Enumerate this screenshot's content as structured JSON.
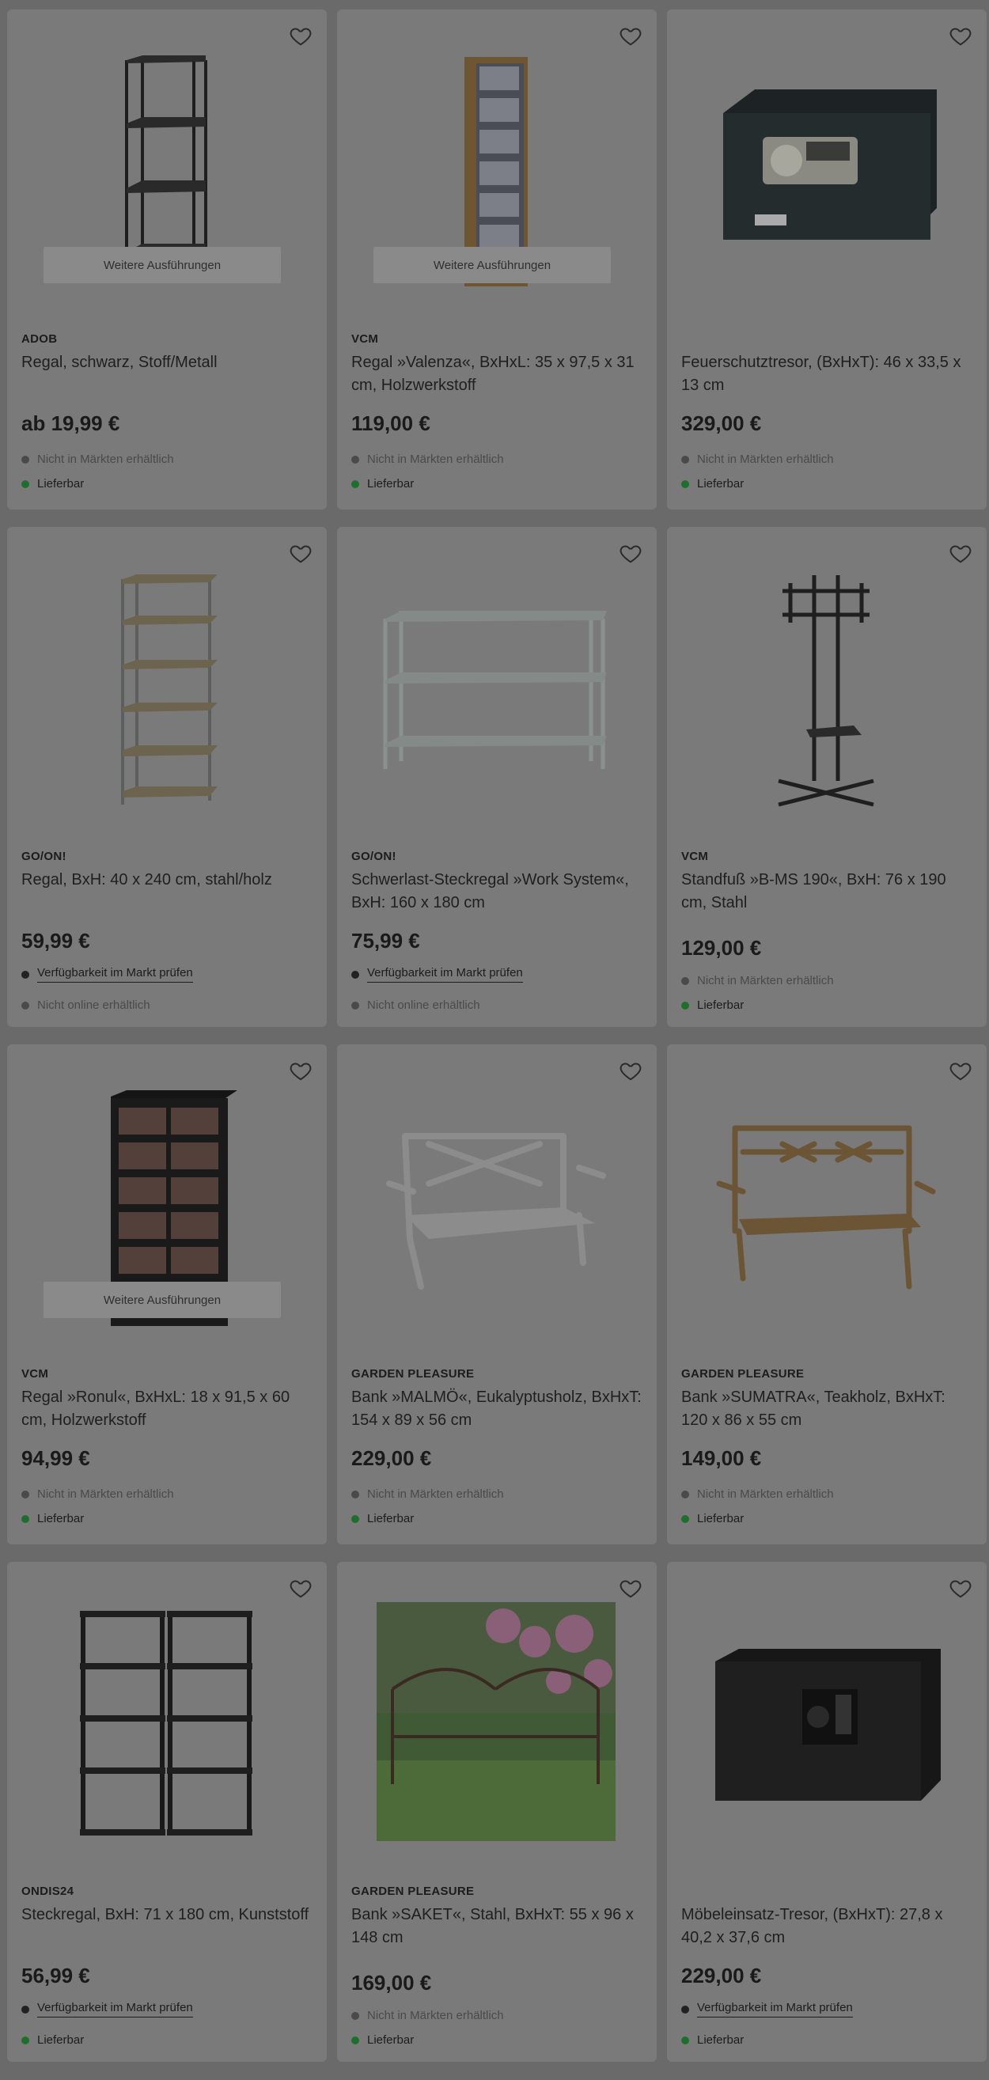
{
  "variants_label": "Weitere Ausführungen",
  "products": [
    {
      "brand": "ADOB",
      "title": "Regal, schwarz, Stoff/Metall",
      "price": "ab 19,99 €",
      "status1": "Nicht in Märkten erhältlich",
      "status2": "Lieferbar",
      "image": "black-metal-shelf-icon"
    },
    {
      "brand": "VCM",
      "title": "Regal »Valenza«, BxHxL: 35 x 97,5 x 31 cm, Holzwerkstoff",
      "price": "119,00 €",
      "status1": "Nicht in Märkten erhältlich",
      "status2": "Lieferbar",
      "image": "cd-tower-icon"
    },
    {
      "brand": "",
      "title": "Feuerschutztresor, (BxHxT): 46 x 33,5 x 13 cm",
      "price": "329,00 €",
      "status1": "Nicht in Märkten erhältlich",
      "status2": "Lieferbar",
      "image": "fire-safe-icon"
    },
    {
      "brand": "GO/ON!",
      "title": "Regal, BxH: 40 x 240 cm, stahl/holz",
      "price": "59,99 €",
      "status1": "Verfügbarkeit im Markt prüfen",
      "status2": "Nicht online erhältlich",
      "image": "steel-wood-shelf-icon"
    },
    {
      "brand": "GO/ON!",
      "title": "Schwerlast-Steckregal »Work System«, BxH: 160 x 180 cm",
      "price": "75,99 €",
      "status1": "Verfügbarkeit im Markt prüfen",
      "status2": "Nicht online erhältlich",
      "image": "heavy-duty-rack-icon"
    },
    {
      "brand": "VCM",
      "title": "Standfuß »B-MS 190«, BxH: 76 x 190 cm, Stahl",
      "price": "129,00 €",
      "status1": "Nicht in Märkten erhältlich",
      "status2": "Lieferbar",
      "image": "tv-stand-icon"
    },
    {
      "brand": "VCM",
      "title": "Regal »Ronul«, BxHxL: 18 x 91,5 x 60 cm, Holzwerkstoff",
      "price": "94,99 €",
      "status1": "Nicht in Märkten erhältlich",
      "status2": "Lieferbar",
      "image": "dvd-shelf-icon"
    },
    {
      "brand": "GARDEN PLEASURE",
      "title": "Bank »MALMÖ«, Eukalyptusholz, BxHxT: 154 x 89 x 56 cm",
      "price": "229,00 €",
      "status1": "Nicht in Märkten erhältlich",
      "status2": "Lieferbar",
      "image": "grey-bench-icon"
    },
    {
      "brand": "GARDEN PLEASURE",
      "title": "Bank »SUMATRA«, Teakholz, BxHxT: 120 x 86 x 55 cm",
      "price": "149,00 €",
      "status1": "Nicht in Märkten erhältlich",
      "status2": "Lieferbar",
      "image": "teak-bench-icon"
    },
    {
      "brand": "ONDIS24",
      "title": "Steckregal, BxH: 71 x 180 cm, Kunststoff",
      "price": "56,99 €",
      "status1": "Verfügbarkeit im Markt prüfen",
      "status2": "Lieferbar",
      "image": "plastic-shelf-icon"
    },
    {
      "brand": "GARDEN PLEASURE",
      "title": "Bank »SAKET«, Stahl, BxHxT: 55 x 96 x 148 cm",
      "price": "169,00 €",
      "status1": "Nicht in Märkten erhältlich",
      "status2": "Lieferbar",
      "image": "garden-bench-photo"
    },
    {
      "brand": "",
      "title": "Möbeleinsatz-Tresor, (BxHxT): 27,8 x 40,2 x 37,6 cm",
      "price": "229,00 €",
      "status1": "Verfügbarkeit im Markt prüfen",
      "status2": "Lieferbar",
      "image": "furniture-safe-icon"
    }
  ]
}
